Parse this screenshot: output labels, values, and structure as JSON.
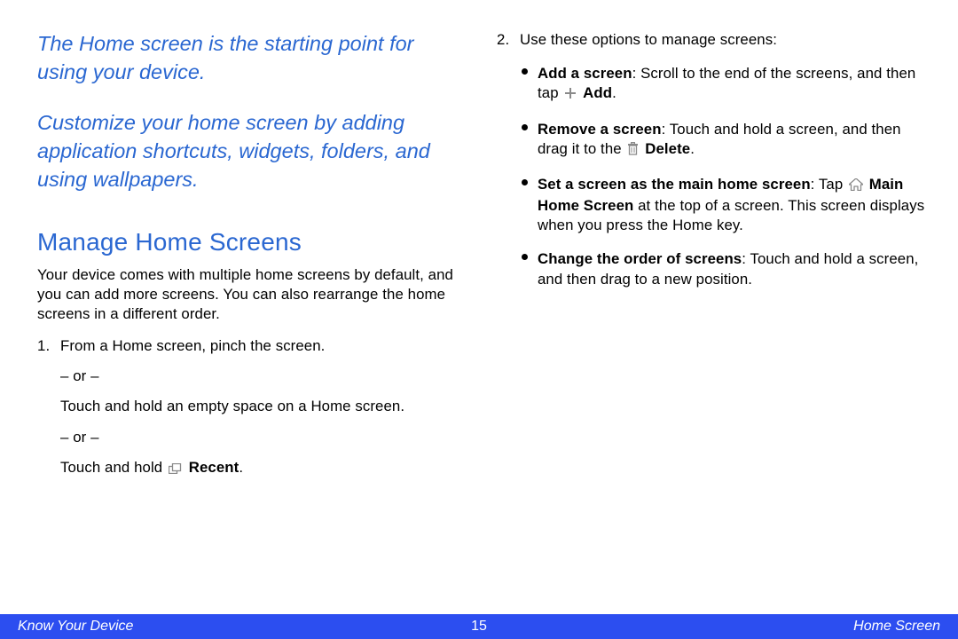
{
  "intro": {
    "p1": "The Home screen is the starting point for using your device.",
    "p2": "Customize your home screen by adding application shortcuts, widgets, folders, and using wallpapers."
  },
  "section_heading": "Manage Home Screens",
  "section_intro": "Your device comes with multiple home screens by default, and you can add more screens. You can also rearrange the home screens in a different order.",
  "step1": {
    "line1": "From a Home screen, pinch the screen.",
    "or": "– or –",
    "line2": "Touch and hold an empty space on a Home screen.",
    "line3_pre": "Touch and hold ",
    "recent_label": "Recent",
    "line3_post": "."
  },
  "step2": {
    "intro": "Use these options to manage screens:",
    "b1_title": "Add a screen",
    "b1_body_pre": ": Scroll to the end of the screens, and then tap ",
    "b1_add_label": "Add",
    "b1_body_post": ".",
    "b2_title": "Remove a screen",
    "b2_body_pre": ": Touch and hold a screen, and then drag it to the ",
    "b2_delete_label": "Delete",
    "b2_body_post": ".",
    "b3_title": "Set a screen as the main home screen",
    "b3_body_pre": ": Tap ",
    "b3_home_label": "Main Home Screen",
    "b3_body_post": " at the top of a screen. This screen displays when you press the Home key.",
    "b4_title": "Change the order of screens",
    "b4_body": ": Touch and hold a screen, and then drag to a new position."
  },
  "footer": {
    "left": "Know Your Device",
    "page": "15",
    "right": "Home Screen"
  },
  "colors": {
    "accent_blue": "#2a67d1",
    "footer_blue": "#2c4ef0"
  }
}
